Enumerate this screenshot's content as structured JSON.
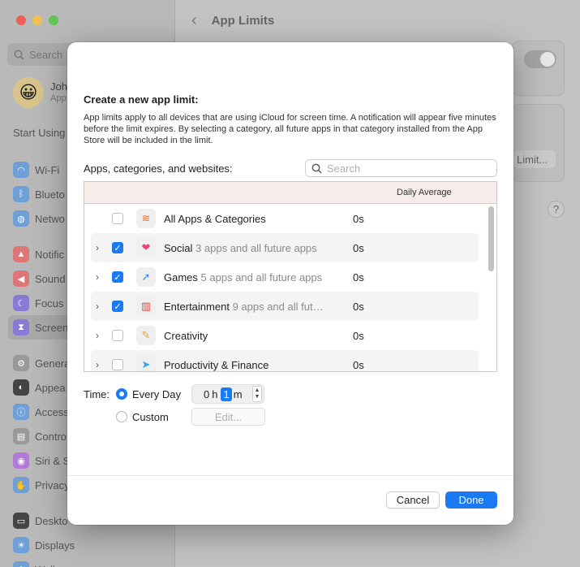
{
  "sidebar": {
    "search_placeholder": "Search",
    "user": {
      "name": "Joh",
      "sub": "App"
    },
    "start_label": "Start Using",
    "items_group1": [
      {
        "label": "Wi-Fi",
        "color": "#6e9fd6",
        "icon": "wifi-icon"
      },
      {
        "label": "Blueto",
        "color": "#6e9fd6",
        "icon": "bluetooth-icon"
      },
      {
        "label": "Netwo",
        "color": "#6e9fd6",
        "icon": "globe-icon"
      }
    ],
    "items_group2": [
      {
        "label": "Notific",
        "color": "#d77",
        "icon": "bell-icon"
      },
      {
        "label": "Sound",
        "color": "#d77",
        "icon": "speaker-icon"
      },
      {
        "label": "Focus",
        "color": "#8a7ad6",
        "icon": "moon-icon"
      },
      {
        "label": "Screen",
        "color": "#8a7ad6",
        "icon": "hourglass-icon"
      }
    ],
    "items_group3": [
      {
        "label": "Genera",
        "color": "#999",
        "icon": "gear-icon"
      },
      {
        "label": "Appea",
        "color": "#444",
        "icon": "appearance-icon"
      },
      {
        "label": "Access",
        "color": "#6e9fd6",
        "icon": "accessibility-icon"
      },
      {
        "label": "Contro",
        "color": "#999",
        "icon": "control-center-icon"
      },
      {
        "label": "Siri & S",
        "color": "#b07ad6",
        "icon": "siri-icon"
      },
      {
        "label": "Privacy",
        "color": "#6e9fd6",
        "icon": "hand-icon"
      }
    ],
    "items_group4": [
      {
        "label": "Deskto",
        "color": "#444",
        "icon": "desktop-icon"
      },
      {
        "label": "Displays",
        "color": "#6e9fd6",
        "icon": "sun-icon"
      },
      {
        "label": "Wallpaper",
        "color": "#6e9fd6",
        "icon": "wallpaper-icon"
      }
    ]
  },
  "main": {
    "title": "App Limits",
    "limit_button": "Limit...",
    "help": "?"
  },
  "dialog": {
    "title": "Create a new app limit:",
    "description": "App limits apply to all devices that are using iCloud for screen time. A notification will appear five minutes before the limit expires. By selecting a category, all future apps in that category installed from the App Store will be included in the limit.",
    "list_label": "Apps, categories, and websites:",
    "search_placeholder": "Search",
    "column_header": "Daily Average",
    "rows": [
      {
        "name": "All Apps & Categories",
        "detail": "",
        "time": "0s",
        "checked": false,
        "expandable": false,
        "icon": "stack-icon"
      },
      {
        "name": "Social",
        "detail": "3 apps and all future apps",
        "time": "0s",
        "checked": true,
        "expandable": true,
        "icon": "chat-bubble-icon"
      },
      {
        "name": "Games",
        "detail": "5 apps and all future apps",
        "time": "0s",
        "checked": true,
        "expandable": true,
        "icon": "rocket-icon"
      },
      {
        "name": "Entertainment",
        "detail": "9 apps and all fut…",
        "time": "0s",
        "checked": true,
        "expandable": true,
        "icon": "popcorn-icon"
      },
      {
        "name": "Creativity",
        "detail": "",
        "time": "0s",
        "checked": false,
        "expandable": true,
        "icon": "palette-icon"
      },
      {
        "name": "Productivity & Finance",
        "detail": "",
        "time": "0s",
        "checked": false,
        "expandable": true,
        "icon": "paper-plane-icon"
      }
    ],
    "time_label": "Time:",
    "every_day_label": "Every Day",
    "custom_label": "Custom",
    "hours": "0",
    "hours_unit": "h",
    "minutes": "1",
    "minutes_unit": "m",
    "edit_label": "Edit...",
    "cancel_label": "Cancel",
    "done_label": "Done",
    "accent": "#1a7af3"
  }
}
